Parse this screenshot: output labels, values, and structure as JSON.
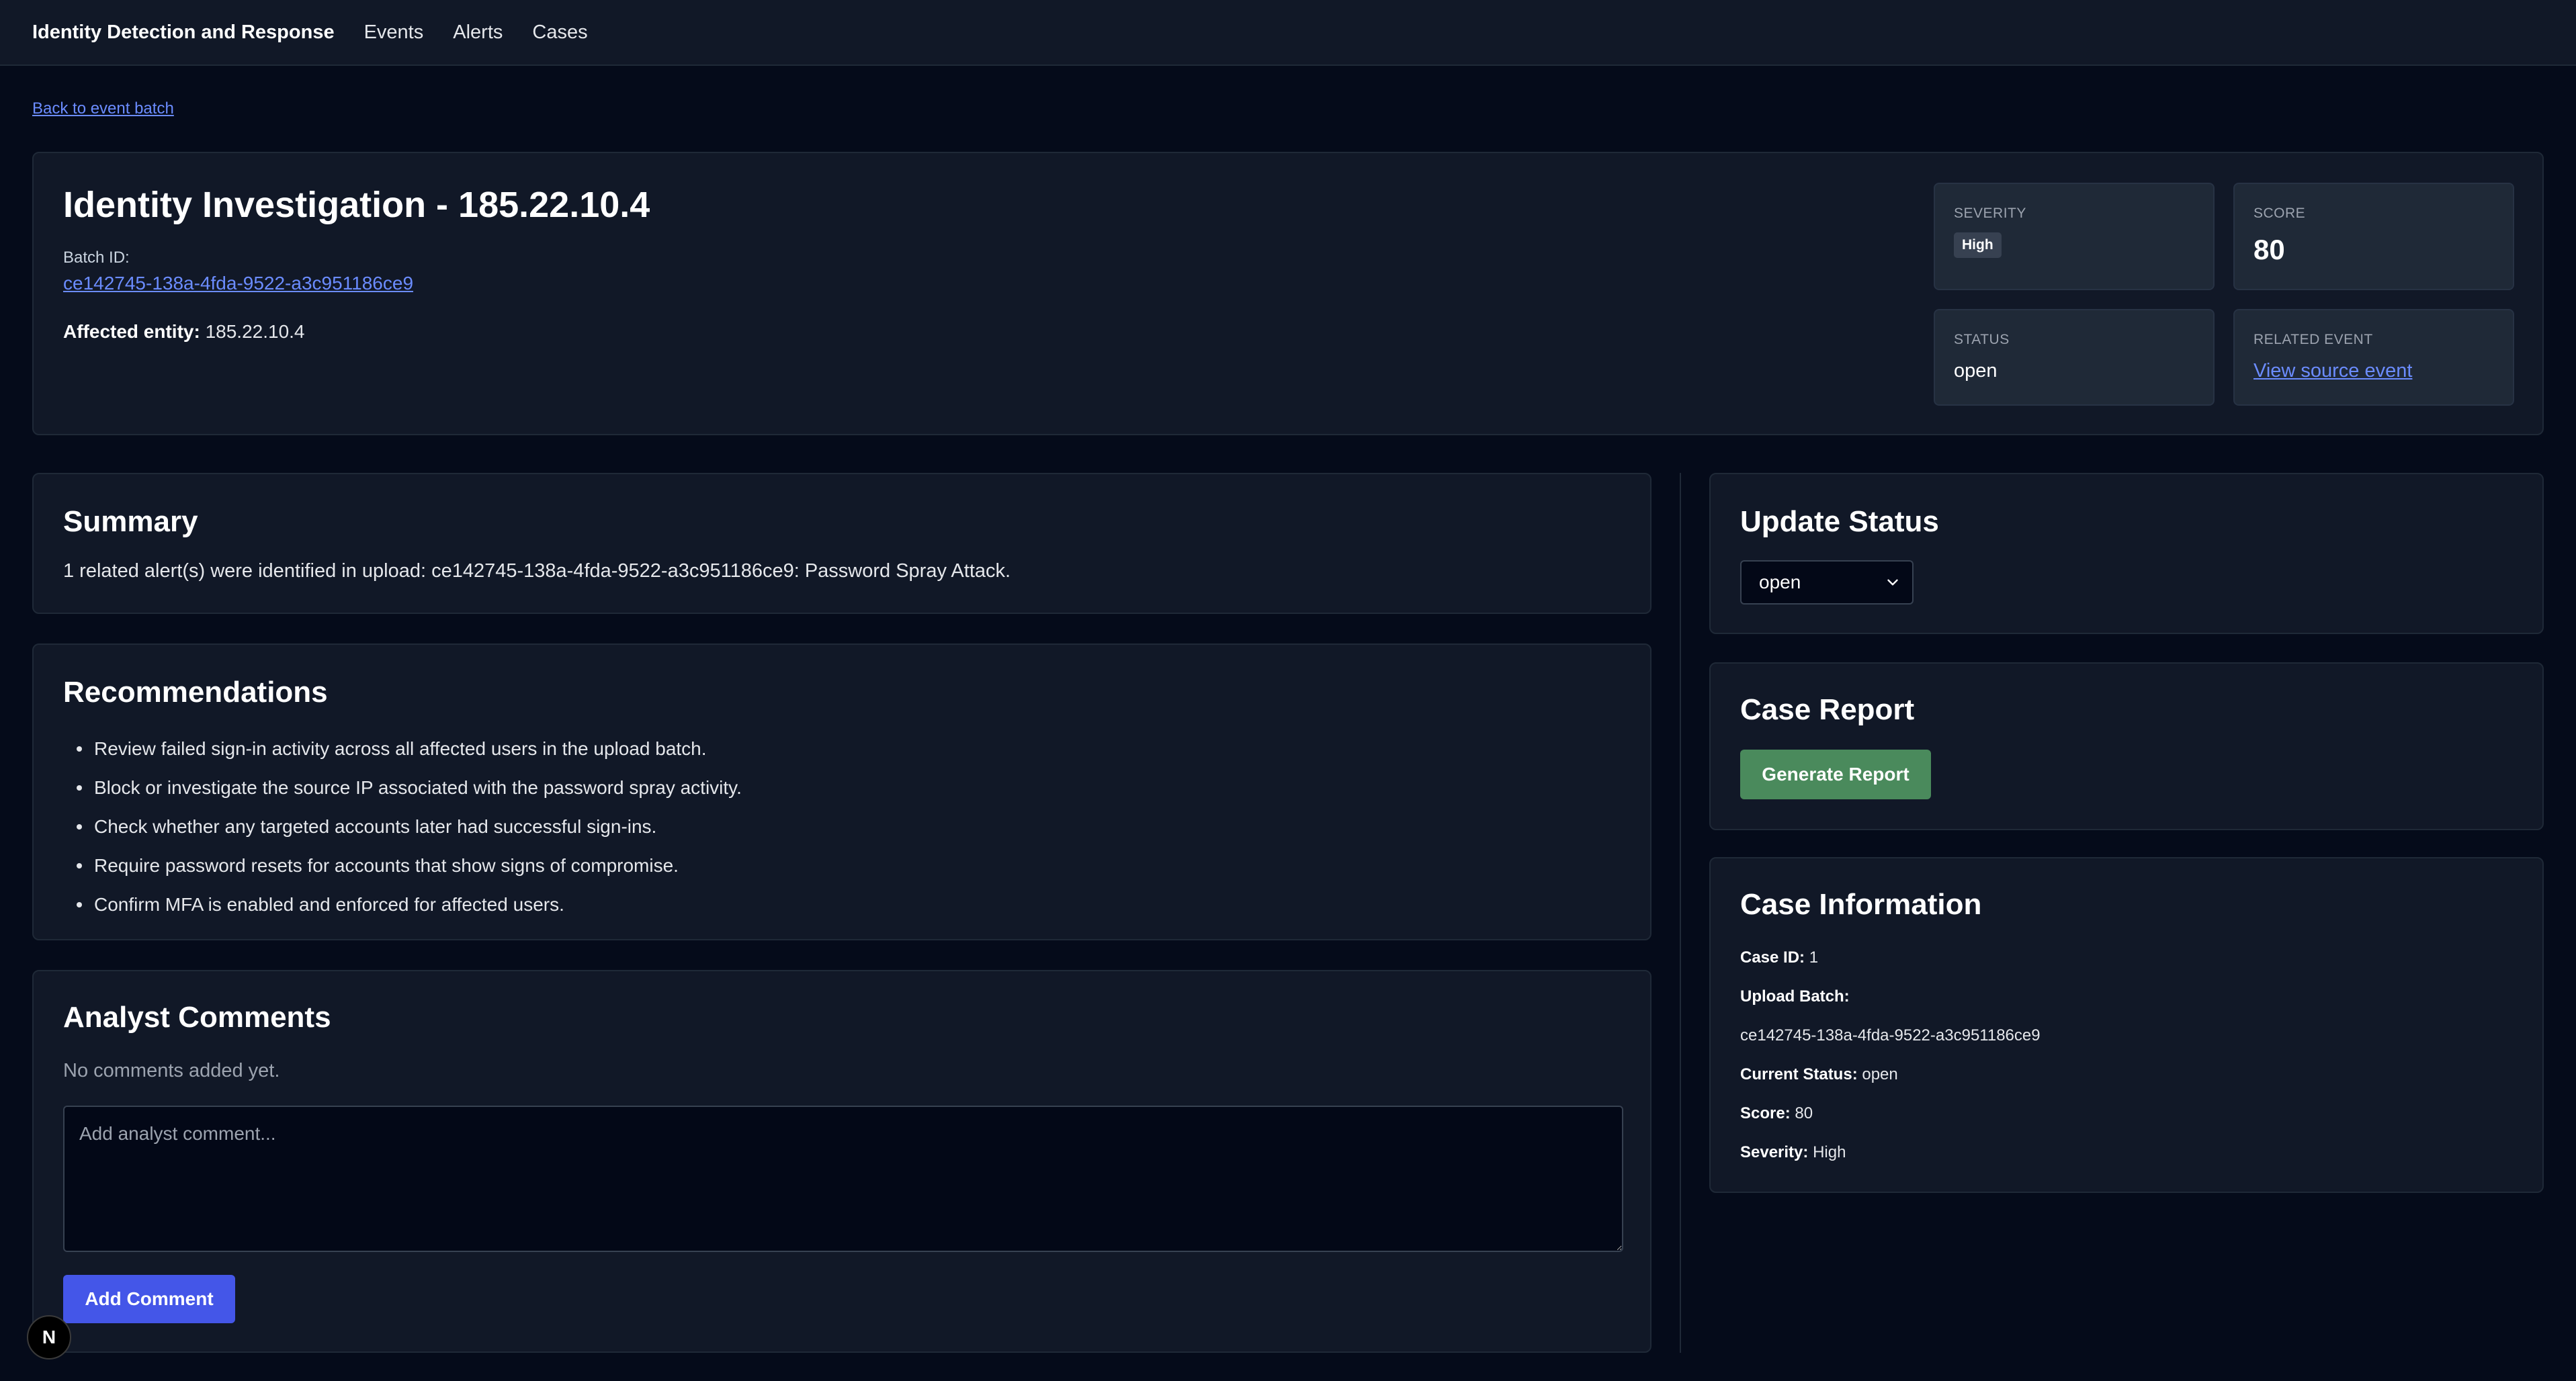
{
  "nav": {
    "brand": "Identity Detection and Response",
    "links": [
      "Events",
      "Alerts",
      "Cases"
    ]
  },
  "back_link": "Back to event batch",
  "header": {
    "title": "Identity Investigation - 185.22.10.4",
    "batch_label": "Batch ID:",
    "batch_id": "ce142745-138a-4fda-9522-a3c951186ce9",
    "affected_label": "Affected entity:",
    "affected_value": "185.22.10.4"
  },
  "stats": {
    "severity_label": "SEVERITY",
    "severity_value": "High",
    "score_label": "SCORE",
    "score_value": "80",
    "status_label": "STATUS",
    "status_value": "open",
    "related_label": "RELATED EVENT",
    "related_link": "View source event"
  },
  "summary": {
    "title": "Summary",
    "text": "1 related alert(s) were identified in upload: ce142745-138a-4fda-9522-a3c951186ce9: Password Spray Attack."
  },
  "recommendations": {
    "title": "Recommendations",
    "items": [
      "Review failed sign-in activity across all affected users in the upload batch.",
      "Block or investigate the source IP associated with the password spray activity.",
      "Check whether any targeted accounts later had successful sign-ins.",
      "Require password resets for accounts that show signs of compromise.",
      "Confirm MFA is enabled and enforced for affected users."
    ]
  },
  "comments": {
    "title": "Analyst Comments",
    "empty_text": "No comments added yet.",
    "placeholder": "Add analyst comment...",
    "button": "Add Comment"
  },
  "update_status": {
    "title": "Update Status",
    "selected": "open"
  },
  "case_report": {
    "title": "Case Report",
    "button": "Generate Report"
  },
  "case_info": {
    "title": "Case Information",
    "case_id_label": "Case ID:",
    "case_id": "1",
    "upload_batch_label": "Upload Batch:",
    "upload_batch": "ce142745-138a-4fda-9522-a3c951186ce9",
    "current_status_label": "Current Status:",
    "current_status": "open",
    "score_label": "Score:",
    "score": "80",
    "severity_label": "Severity:",
    "severity": "High"
  },
  "framework_badge": "N",
  "colors": {
    "background": "#050b1a",
    "card": "#111827",
    "link": "#6b8cff",
    "primary_button": "#4456e8",
    "report_button": "#4a8a5c"
  }
}
